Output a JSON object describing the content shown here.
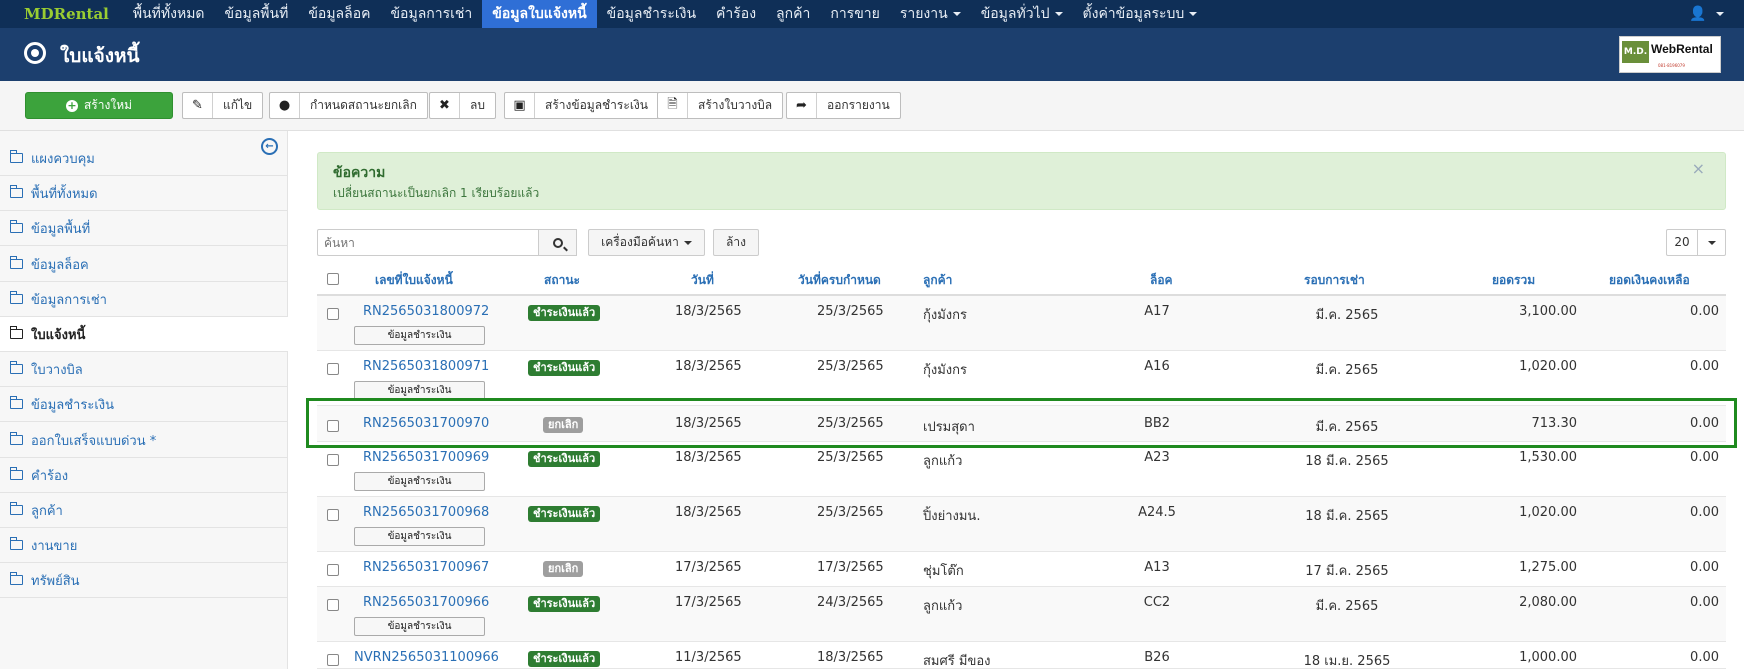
{
  "nav": {
    "brand": "MDRental",
    "items": [
      {
        "label": "พื้นที่ทั้งหมด",
        "caret": false
      },
      {
        "label": "ข้อมูลพื้นที่",
        "caret": false
      },
      {
        "label": "ข้อมูลล็อค",
        "caret": false
      },
      {
        "label": "ข้อมูลการเช่า",
        "caret": false
      },
      {
        "label": "ข้อมูลใบแจ้งหนี้",
        "caret": false
      },
      {
        "label": "ข้อมูลชำระเงิน",
        "caret": false
      },
      {
        "label": "คำร้อง",
        "caret": false
      },
      {
        "label": "ลูกค้า",
        "caret": false
      },
      {
        "label": "การขาย",
        "caret": false
      },
      {
        "label": "รายงาน",
        "caret": true
      },
      {
        "label": "ข้อมูลทั่วไป",
        "caret": true
      },
      {
        "label": "ตั้งค่าข้อมูลระบบ",
        "caret": true
      }
    ],
    "active_index": 4,
    "user_icon": "user-icon"
  },
  "header": {
    "title": "ใบแจ้งหนี้",
    "logo": {
      "md": "M.D.",
      "name": "WebRental",
      "sub": "081-8196079"
    }
  },
  "toolbar": {
    "new_label": "สร้างใหม่",
    "edit_label": "แก้ไข",
    "set_cancel_label": "กำหนดสถานะยกเลิก",
    "delete_label": "ลบ",
    "create_payment_label": "สร้างข้อมูลชำระเงิน",
    "create_bill_label": "สร้างใบวางบิล",
    "export_label": "ออกรายงาน"
  },
  "sidebar": {
    "items": [
      {
        "label": "แผงควบคุม"
      },
      {
        "label": "พื้นที่ทั้งหมด"
      },
      {
        "label": "ข้อมูลพื้นที่"
      },
      {
        "label": "ข้อมูลล็อค"
      },
      {
        "label": "ข้อมูลการเช่า"
      },
      {
        "label": "ใบแจ้งหนี้"
      },
      {
        "label": "ใบวางบิล"
      },
      {
        "label": "ข้อมูลชำระเงิน"
      },
      {
        "label": "ออกใบเสร็จแบบด่วน *"
      },
      {
        "label": "คำร้อง"
      },
      {
        "label": "ลูกค้า"
      },
      {
        "label": "งานขาย"
      },
      {
        "label": "ทรัพย์สิน"
      }
    ],
    "active_index": 5
  },
  "alert": {
    "title": "ข้อความ",
    "message": "เปลี่ยนสถานะเป็นยกเลิก 1 เรียบร้อยแล้ว",
    "close": "×"
  },
  "search": {
    "placeholder": "ค้นหา",
    "tools_label": "เครื่องมือค้นหา",
    "clear_label": "ล้าง",
    "page_size": "20"
  },
  "table": {
    "headers": {
      "invoice_no": "เลขที่ใบแจ้งหนี้",
      "status": "สถานะ",
      "date": "วันที่",
      "due_date": "วันที่ครบกำหนด",
      "customer": "ลูกค้า",
      "lock": "ล็อค",
      "period": "รอบการเช่า",
      "total": "ยอดรวม",
      "balance": "ยอดเงินคงเหลือ"
    },
    "payment_button_label": "ข้อมูลชำระเงิน",
    "status_labels": {
      "paid": "ชำระเงินแล้ว",
      "cancel": "ยกเลิก"
    },
    "status_colors": {
      "paid": "#2e7d32",
      "cancel": "#9e9e9e"
    },
    "rows": [
      {
        "invoice_no": "RN2565031800972",
        "status": "ชำระเงินแล้ว",
        "date": "18/3/2565",
        "due_date": "25/3/2565",
        "customer": "กุ้งมังกร",
        "lock": "A17",
        "period": "มี.ค. 2565",
        "total": "3,100.00",
        "balance": "0.00"
      },
      {
        "invoice_no": "RN2565031800971",
        "status": "ชำระเงินแล้ว",
        "date": "18/3/2565",
        "due_date": "25/3/2565",
        "customer": "กุ้งมังกร",
        "lock": "A16",
        "period": "มี.ค. 2565",
        "total": "1,020.00",
        "balance": "0.00"
      },
      {
        "invoice_no": "RN2565031700970",
        "status": "ยกเลิก",
        "date": "18/3/2565",
        "due_date": "25/3/2565",
        "customer": "เปรมสุดา",
        "lock": "BB2",
        "period": "มี.ค. 2565",
        "total": "713.30",
        "balance": "0.00"
      },
      {
        "invoice_no": "RN2565031700969",
        "status": "ชำระเงินแล้ว",
        "date": "18/3/2565",
        "due_date": "25/3/2565",
        "customer": "ลูกแก้ว",
        "lock": "A23",
        "period": "18 มี.ค. 2565",
        "total": "1,530.00",
        "balance": "0.00"
      },
      {
        "invoice_no": "RN2565031700968",
        "status": "ชำระเงินแล้ว",
        "date": "18/3/2565",
        "due_date": "25/3/2565",
        "customer": "ปิ้งย่างมน.",
        "lock": "A24.5",
        "period": "18 มี.ค. 2565",
        "total": "1,020.00",
        "balance": "0.00"
      },
      {
        "invoice_no": "RN2565031700967",
        "status": "ยกเลิก",
        "date": "17/3/2565",
        "due_date": "17/3/2565",
        "customer": "ชุ่มโต๊ก",
        "lock": "A13",
        "period": "17 มี.ค. 2565",
        "total": "1,275.00",
        "balance": "0.00"
      },
      {
        "invoice_no": "RN2565031700966",
        "status": "ชำระเงินแล้ว",
        "date": "17/3/2565",
        "due_date": "24/3/2565",
        "customer": "ลูกแก้ว",
        "lock": "CC2",
        "period": "มี.ค. 2565",
        "total": "2,080.00",
        "balance": "0.00"
      },
      {
        "invoice_no": "NVRN2565031100966",
        "status": "ชำระเงินแล้ว",
        "date": "11/3/2565",
        "due_date": "18/3/2565",
        "customer": "สมศรี มีของ",
        "lock": "B26",
        "period": "18 เม.ย. 2565",
        "total": "1,000.00",
        "balance": "0.00"
      }
    ]
  }
}
